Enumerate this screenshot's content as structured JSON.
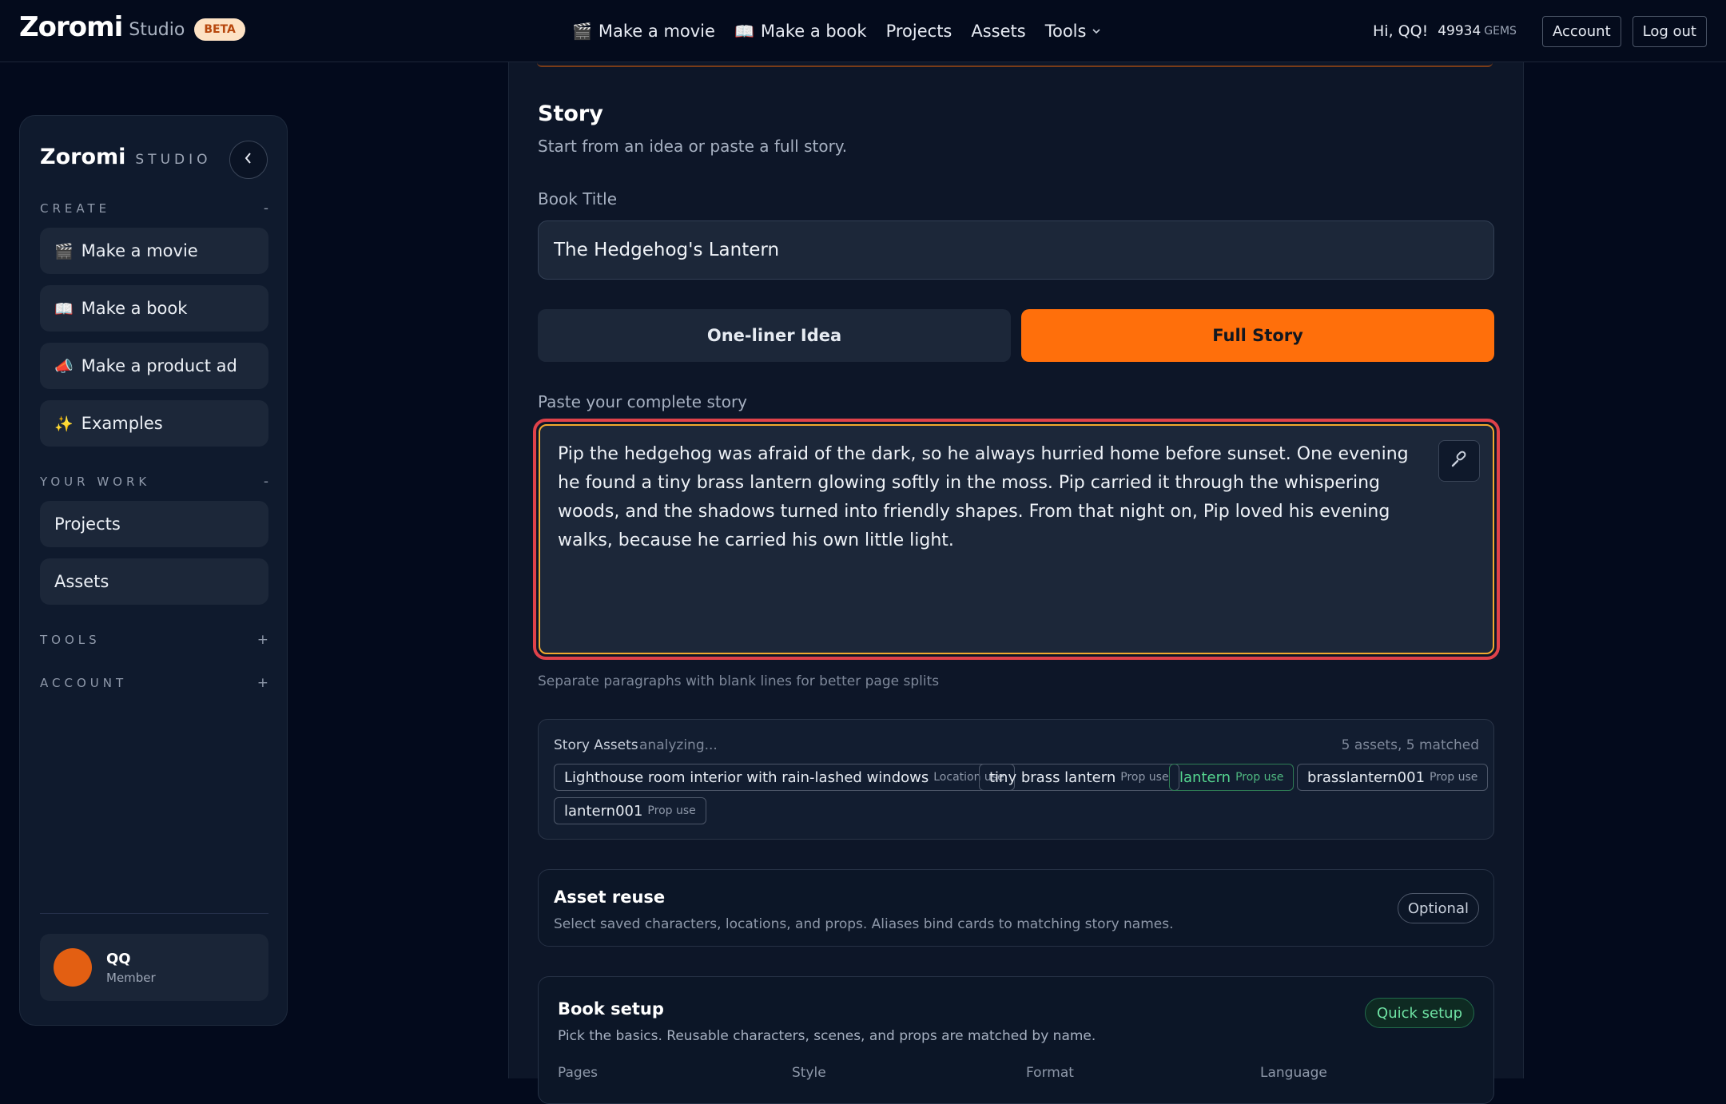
{
  "topbar": {
    "brand": "Zoromi",
    "brand_sub": "Studio",
    "beta": "BETA",
    "nav": [
      {
        "label": "Make a movie",
        "icon": "🎬"
      },
      {
        "label": "Make a book",
        "icon": "📖"
      },
      {
        "label": "Projects"
      },
      {
        "label": "Assets"
      },
      {
        "label": "Tools"
      }
    ],
    "greeting": "Hi, QQ!",
    "gems_value": "49934",
    "gems_unit": "GEMS",
    "account_label": "Account",
    "logout_label": "Log out"
  },
  "sidebar": {
    "brand": "Zoromi",
    "brand_sub": "STUDIO",
    "create_head": "CREATE",
    "create_toggle": "-",
    "create_items": [
      {
        "label": "Make a movie",
        "icon": "🎬"
      },
      {
        "label": "Make a book",
        "icon": "📖"
      },
      {
        "label": "Make a product ad",
        "icon": "📣"
      },
      {
        "label": "Examples",
        "icon": "✨"
      }
    ],
    "work_head": "YOUR WORK",
    "work_toggle": "-",
    "work_items": [
      {
        "label": "Projects"
      },
      {
        "label": "Assets"
      }
    ],
    "tools_head": "TOOLS",
    "tools_toggle": "+",
    "account_head": "ACCOUNT",
    "account_toggle": "+",
    "user": {
      "name": "QQ",
      "role": "Member",
      "avatar_color": "#e35f12"
    }
  },
  "story": {
    "heading": "Story",
    "subheading": "Start from an idea or paste a full story.",
    "title_label": "Book Title",
    "title_value": "The Hedgehog's Lantern",
    "mode_oneliner": "One-liner Idea",
    "mode_full": "Full Story",
    "paste_label": "Paste your complete story",
    "story_text": "Pip the hedgehog was afraid of the dark, so he always hurried home before sunset. One evening he found a tiny brass lantern glowing softly in the moss. Pip carried it through the whispering woods, and the shadows turned into friendly shapes. From that night on, Pip loved his evening walks, because he carried his own little light.",
    "hint": "Separate paragraphs with blank lines for better page splits"
  },
  "assets": {
    "title": "Story Assets",
    "status": "analyzing...",
    "count": "5 assets, 5 matched",
    "chips": [
      {
        "name": "Lighthouse room interior with rain-lashed windows",
        "kind": "Location use",
        "matched": false
      },
      {
        "name": "tiny brass lantern",
        "kind": "Prop use",
        "matched": false
      },
      {
        "name": "lantern",
        "kind": "Prop use",
        "matched": true
      },
      {
        "name": "brasslantern001",
        "kind": "Prop use",
        "matched": false
      },
      {
        "name": "lantern001",
        "kind": "Prop use",
        "matched": false
      }
    ]
  },
  "reuse": {
    "title": "Asset reuse",
    "description": "Select saved characters, locations, and props. Aliases bind cards to matching story names.",
    "badge": "Optional"
  },
  "setup": {
    "title": "Book setup",
    "description": "Pick the basics. Reusable characters, scenes, and props are matched by name.",
    "badge": "Quick setup",
    "columns": [
      "Pages",
      "Style",
      "Format",
      "Language"
    ]
  },
  "colors": {
    "accent": "#ff6f0b",
    "focus_ring": "#e0424a",
    "matched": "#55d58f"
  }
}
